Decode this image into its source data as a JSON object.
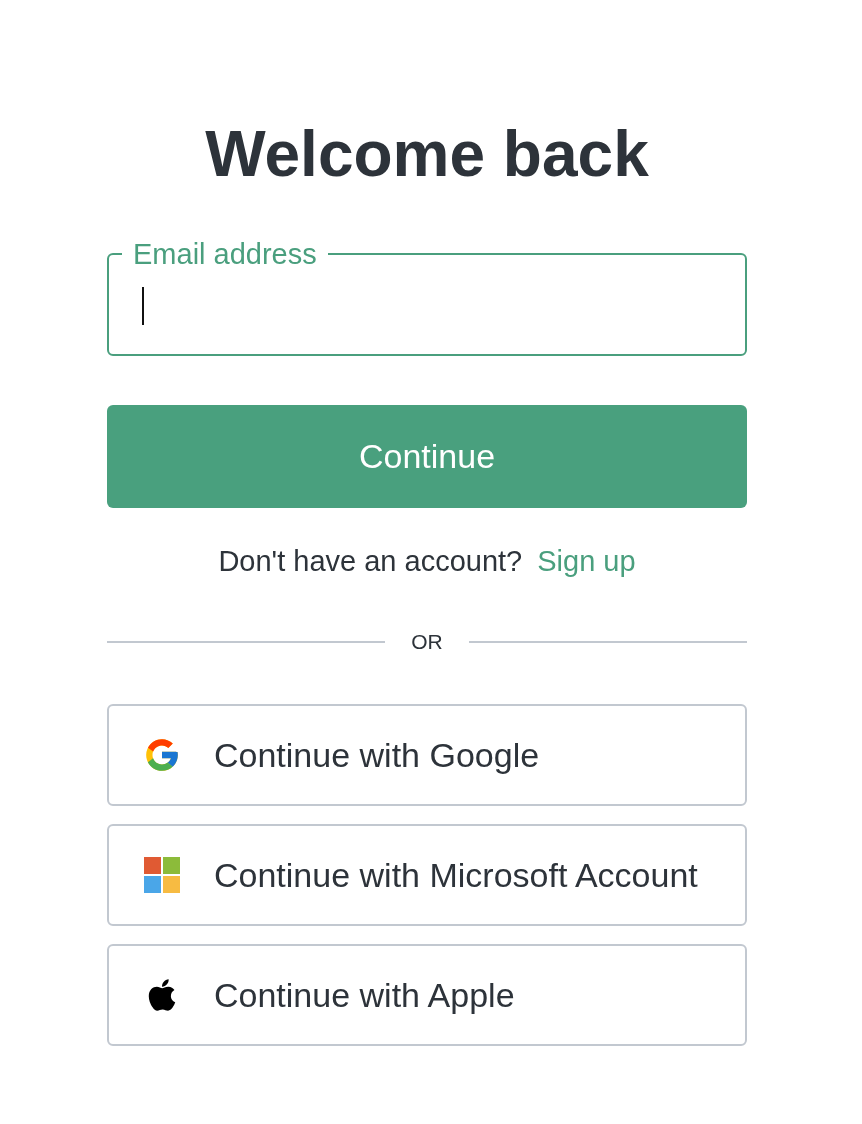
{
  "heading": "Welcome back",
  "email_field": {
    "label": "Email address",
    "focused": true
  },
  "continue_button": "Continue",
  "signup_prompt": {
    "text": "Don't have an account?",
    "link": "Sign up"
  },
  "divider": "OR",
  "providers": [
    {
      "kind": "google",
      "label": "Continue with Google"
    },
    {
      "kind": "microsoft",
      "label": "Continue with Microsoft Account"
    },
    {
      "kind": "apple",
      "label": "Continue with Apple"
    }
  ]
}
